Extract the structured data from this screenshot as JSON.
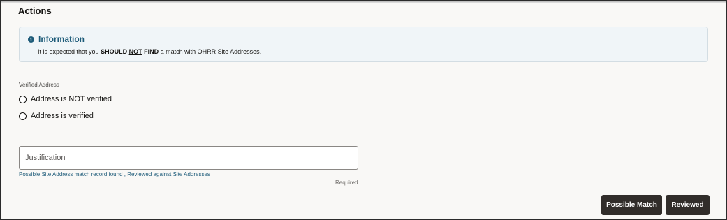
{
  "section": {
    "title": "Actions"
  },
  "info": {
    "title": "Information",
    "text_prefix": "It is expected that you ",
    "text_should": "SHOULD",
    "text_not": "NOT",
    "text_find": "FIND",
    "text_suffix": " a match with OHRR Site Addresses.",
    "icon": "info-icon",
    "accent_color": "#1d5b79"
  },
  "verified_address": {
    "label": "Verified Address",
    "options": [
      {
        "label": "Address is NOT verified",
        "selected": false
      },
      {
        "label": "Address is verified",
        "selected": false
      }
    ]
  },
  "justification": {
    "placeholder": "Justification",
    "value": "",
    "helper_text": "Possible Site Address match record found , Reviewed against Site Addresses",
    "required_text": "Required"
  },
  "buttons": {
    "possible_match": "Possible Match",
    "reviewed": "Reviewed",
    "color": "#312d2a"
  }
}
